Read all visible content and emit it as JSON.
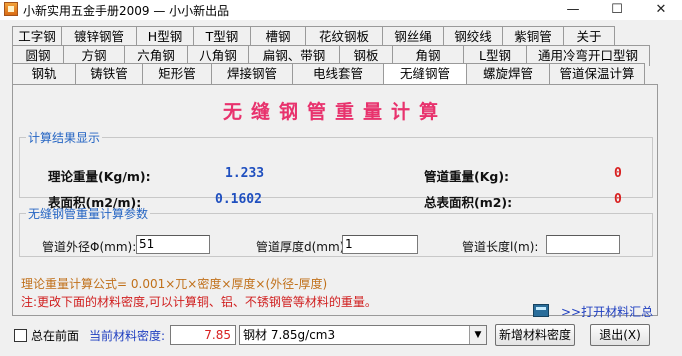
{
  "window": {
    "title": "小新实用五金手册2009 — 小小新出品",
    "minimize": "—",
    "maximize": "☐",
    "close": "✕"
  },
  "tabs": {
    "row1": [
      "工字钢",
      "镀锌钢管",
      "H型钢",
      "T型钢",
      "槽钢",
      "花纹钢板",
      "钢丝绳",
      "钢绞线",
      "紫铜管",
      "关于"
    ],
    "row2": [
      "圆钢",
      "方钢",
      "六角钢",
      "八角钢",
      "扁钢、带钢",
      "钢板",
      "角钢",
      "L型钢",
      "通用冷弯开口型钢"
    ],
    "row3": [
      "钢轨",
      "铸铁管",
      "矩形管",
      "焊接钢管",
      "电线套管",
      "无缝钢管",
      "螺旋焊管",
      "管道保温计算"
    ],
    "active": "无缝钢管"
  },
  "main": {
    "heading": "无缝钢管重量计算",
    "results": {
      "legend": "计算结果显示",
      "theory_weight_label": "理论重量(Kg/m):",
      "theory_weight_value": "1.233",
      "surface_label": "表面积(m2/m):",
      "surface_value": "0.1602",
      "pipe_weight_label": "管道重量(Kg):",
      "pipe_weight_value": "0",
      "total_surface_label": "总表面积(m2):",
      "total_surface_value": "0"
    },
    "params": {
      "legend": "无缝钢管重量计算参数",
      "outer_label": "管道外径Φ(mm):",
      "outer_value": "51",
      "thickness_label": "管道厚度d(mm):",
      "thickness_value": "1",
      "length_label": "管道长度l(m):",
      "length_value": ""
    },
    "formula": "理论重量计算公式= 0.001×兀×密度×厚度×(外径-厚度)",
    "note": "注:更改下面的材料密度,可以计算铜、铝、不锈钢管等材料的重量。",
    "summary_link": ">>打开材料汇总"
  },
  "bottom": {
    "always_on_top": "总在前面",
    "density_label": "当前材料密度:",
    "density_value": "7.85",
    "material_selected": "钢材 7.85g/cm3",
    "new_density_button": "新增材料密度",
    "exit_button": "退出(X)"
  }
}
